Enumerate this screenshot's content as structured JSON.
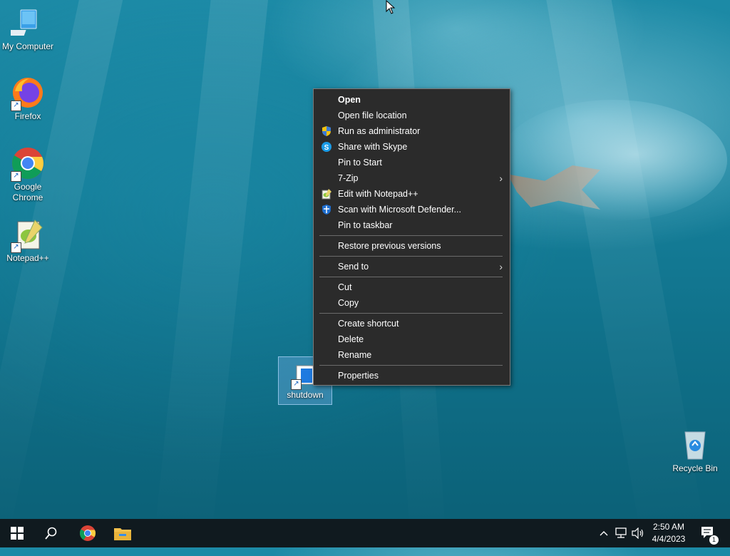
{
  "desktop": {
    "icons": [
      {
        "label": "My Computer",
        "icon": "computer-icon"
      },
      {
        "label": "Firefox",
        "icon": "firefox-icon"
      },
      {
        "label": "Google Chrome",
        "icon": "chrome-icon"
      },
      {
        "label": "Notepad++",
        "icon": "notepadpp-icon"
      },
      {
        "label": "shutdown",
        "icon": "shortcut-app-icon"
      },
      {
        "label": "Recycle Bin",
        "icon": "recycle-bin-icon"
      }
    ]
  },
  "context_menu": {
    "items": [
      {
        "label": "Open",
        "bold": true
      },
      {
        "label": "Open file location"
      },
      {
        "label": "Run as administrator",
        "icon": "uac-shield-icon"
      },
      {
        "label": "Share with Skype",
        "icon": "skype-icon"
      },
      {
        "label": "Pin to Start"
      },
      {
        "label": "7-Zip",
        "submenu": true
      },
      {
        "label": "Edit with Notepad++",
        "icon": "notepadpp-icon"
      },
      {
        "label": "Scan with Microsoft Defender...",
        "icon": "defender-icon"
      },
      {
        "label": "Pin to taskbar"
      },
      {
        "label": "Restore previous versions"
      },
      {
        "label": "Send to",
        "submenu": true
      },
      {
        "label": "Cut"
      },
      {
        "label": "Copy"
      },
      {
        "label": "Create shortcut"
      },
      {
        "label": "Delete"
      },
      {
        "label": "Rename"
      },
      {
        "label": "Properties"
      }
    ]
  },
  "taskbar": {
    "buttons": [
      "start-icon",
      "search-icon",
      "chrome-icon",
      "file-explorer-icon"
    ],
    "tray_icons": [
      "chevron-up-icon",
      "network-icon",
      "volume-icon"
    ],
    "time": "2:50 AM",
    "date": "4/4/2023",
    "notifications_count": "1"
  },
  "colors": {
    "menu_bg": "#2b2b2b",
    "taskbar_bg": "#101a1f",
    "selection": "#66a6d9"
  }
}
